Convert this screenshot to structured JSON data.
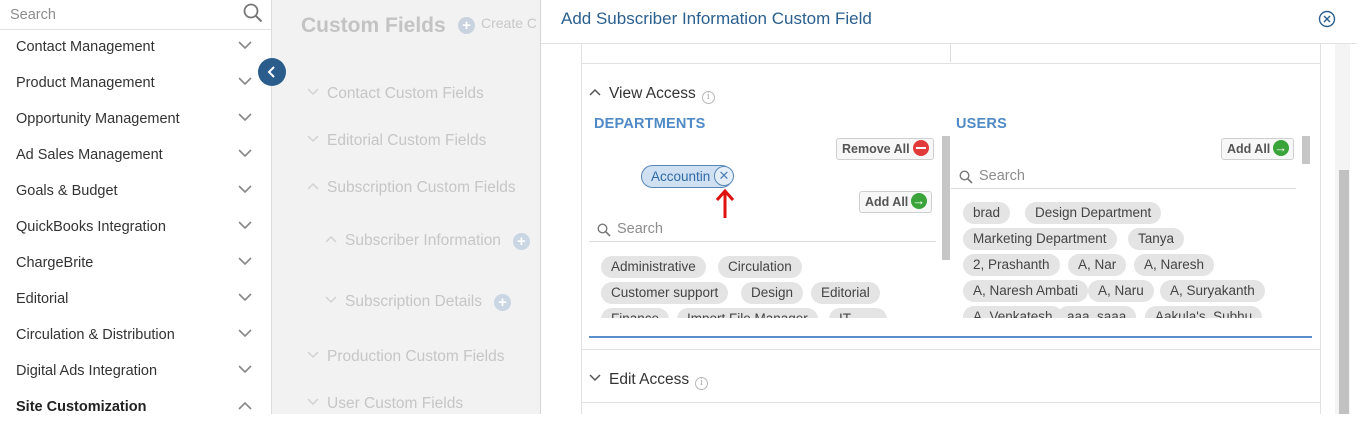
{
  "sidebar": {
    "search_placeholder": "Search",
    "items": [
      {
        "label": "Contact Management"
      },
      {
        "label": "Product Management"
      },
      {
        "label": "Opportunity Management"
      },
      {
        "label": "Ad Sales Management"
      },
      {
        "label": "Goals & Budget"
      },
      {
        "label": "QuickBooks Integration"
      },
      {
        "label": "ChargeBrite"
      },
      {
        "label": "Editorial"
      },
      {
        "label": "Circulation & Distribution"
      },
      {
        "label": "Digital Ads Integration"
      },
      {
        "label": "Site Customization"
      }
    ],
    "active_item": "Site Customization"
  },
  "background_page": {
    "title": "Custom Fields",
    "create_label": "Create C",
    "items": [
      {
        "label": "Contact Custom Fields"
      },
      {
        "label": "Editorial Custom Fields"
      },
      {
        "label": "Subscription Custom Fields"
      },
      {
        "label": "Subscriber Information"
      },
      {
        "label": "Subscription Details"
      },
      {
        "label": "Production Custom Fields"
      },
      {
        "label": "User Custom Fields"
      }
    ]
  },
  "modal": {
    "title": "Add Subscriber Information Custom Field",
    "view_access": {
      "heading": "View Access",
      "departments": {
        "label": "DEPARTMENTS",
        "remove_all_label": "Remove All",
        "add_all_label": "Add All",
        "selected": [
          "Accountin"
        ],
        "search_placeholder": "Search",
        "available": [
          "Administrative",
          "Circulation",
          "Customer support",
          "Design",
          "Editorial",
          "Finance",
          "Import File Manager",
          "IT"
        ]
      },
      "users": {
        "label": "USERS",
        "add_all_label": "Add All",
        "search_placeholder": "Search",
        "available": [
          "brad",
          "Design Department",
          "Marketing Department",
          "Tanya",
          "2, Prashanth",
          "A, Nar",
          "A, Naresh",
          "A, Naresh Ambati",
          "A, Naru",
          "A, Suryakanth",
          "A, Venkatesh",
          "aaa, saaa",
          "Aakula's, Subhu"
        ]
      }
    },
    "edit_access": {
      "heading": "Edit Access"
    }
  },
  "colors": {
    "accent": "#2b5f8e",
    "section_label": "#4f8ac6",
    "selected_tag_bg": "#cfe0f3",
    "annotation_arrow": "#e01010"
  }
}
